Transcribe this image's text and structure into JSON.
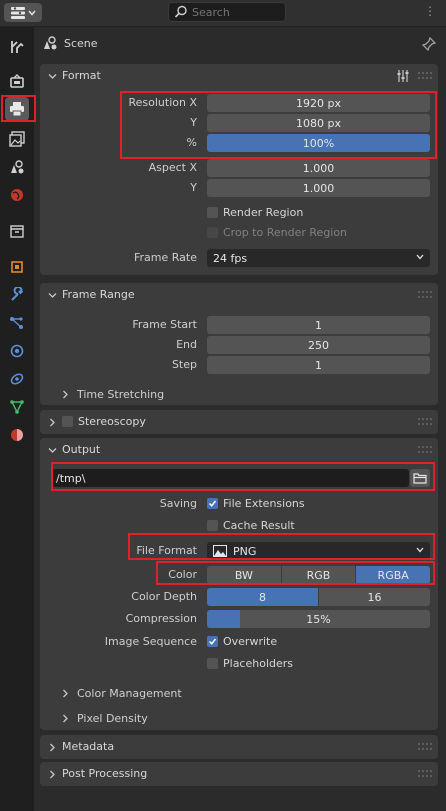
{
  "header": {
    "search_placeholder": "Search"
  },
  "context": {
    "scene_label": "Scene"
  },
  "format": {
    "title": "Format",
    "resolution_x_label": "Resolution X",
    "resolution_x": "1920 px",
    "resolution_y_label": "Y",
    "resolution_y": "1080 px",
    "percent_label": "%",
    "percent": "100%",
    "aspect_x_label": "Aspect X",
    "aspect_x": "1.000",
    "aspect_y_label": "Y",
    "aspect_y": "1.000",
    "render_region": "Render Region",
    "crop_region": "Crop to Render Region",
    "frame_rate_label": "Frame Rate",
    "frame_rate": "24 fps"
  },
  "frame_range": {
    "title": "Frame Range",
    "start_label": "Frame Start",
    "start": "1",
    "end_label": "End",
    "end": "250",
    "step_label": "Step",
    "step": "1",
    "time_stretching": "Time Stretching"
  },
  "stereoscopy": {
    "title": "Stereoscopy"
  },
  "output": {
    "title": "Output",
    "path": "/tmp\\",
    "saving_label": "Saving",
    "file_extensions": "File Extensions",
    "cache_result": "Cache Result",
    "file_format_label": "File Format",
    "file_format": "PNG",
    "color_label": "Color",
    "color_options": [
      "BW",
      "RGB",
      "RGBA"
    ],
    "color_depth_label": "Color Depth",
    "depth_options": [
      "8",
      "16"
    ],
    "compression_label": "Compression",
    "compression": "15%",
    "compression_value": 0.15,
    "image_sequence_label": "Image Sequence",
    "overwrite": "Overwrite",
    "placeholders": "Placeholders",
    "color_management": "Color Management",
    "pixel_density": "Pixel Density"
  },
  "metadata": {
    "title": "Metadata"
  },
  "post_processing": {
    "title": "Post Processing"
  },
  "colors": {
    "accent": "#4772b3",
    "highlight": "#e0202a",
    "panel": "#3c3c3c",
    "field": "#545454"
  }
}
